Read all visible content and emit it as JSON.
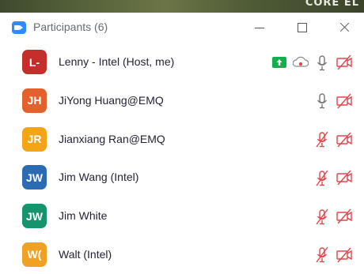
{
  "background_strip": {
    "text": "CORE EL"
  },
  "window": {
    "title": "Participants (6)"
  },
  "colors": {
    "mic_muted": "#e0454c",
    "video_off": "#e0454c",
    "mic_on": "#777777",
    "share": "#12b048"
  },
  "participants": [
    {
      "initials": "L-",
      "name": "Lenny - Intel (Host, me)",
      "avatar_color": "#c42f2b",
      "sharing": true,
      "recording": true,
      "mic": "on",
      "video": "off"
    },
    {
      "initials": "JH",
      "name": "JiYong Huang@EMQ",
      "avatar_color": "#e3612c",
      "sharing": false,
      "recording": false,
      "mic": "on",
      "video": "off"
    },
    {
      "initials": "JR",
      "name": "Jianxiang Ran@EMQ",
      "avatar_color": "#f3a417",
      "sharing": false,
      "recording": false,
      "mic": "muted",
      "video": "off"
    },
    {
      "initials": "JW",
      "name": "Jim Wang (Intel)",
      "avatar_color": "#2a6bb3",
      "sharing": false,
      "recording": false,
      "mic": "muted",
      "video": "off"
    },
    {
      "initials": "JW",
      "name": "Jim White",
      "avatar_color": "#16946e",
      "sharing": false,
      "recording": false,
      "mic": "muted",
      "video": "off"
    },
    {
      "initials": "W(",
      "name": "Walt (Intel)",
      "avatar_color": "#f0a022",
      "sharing": false,
      "recording": false,
      "mic": "muted",
      "video": "off"
    }
  ]
}
